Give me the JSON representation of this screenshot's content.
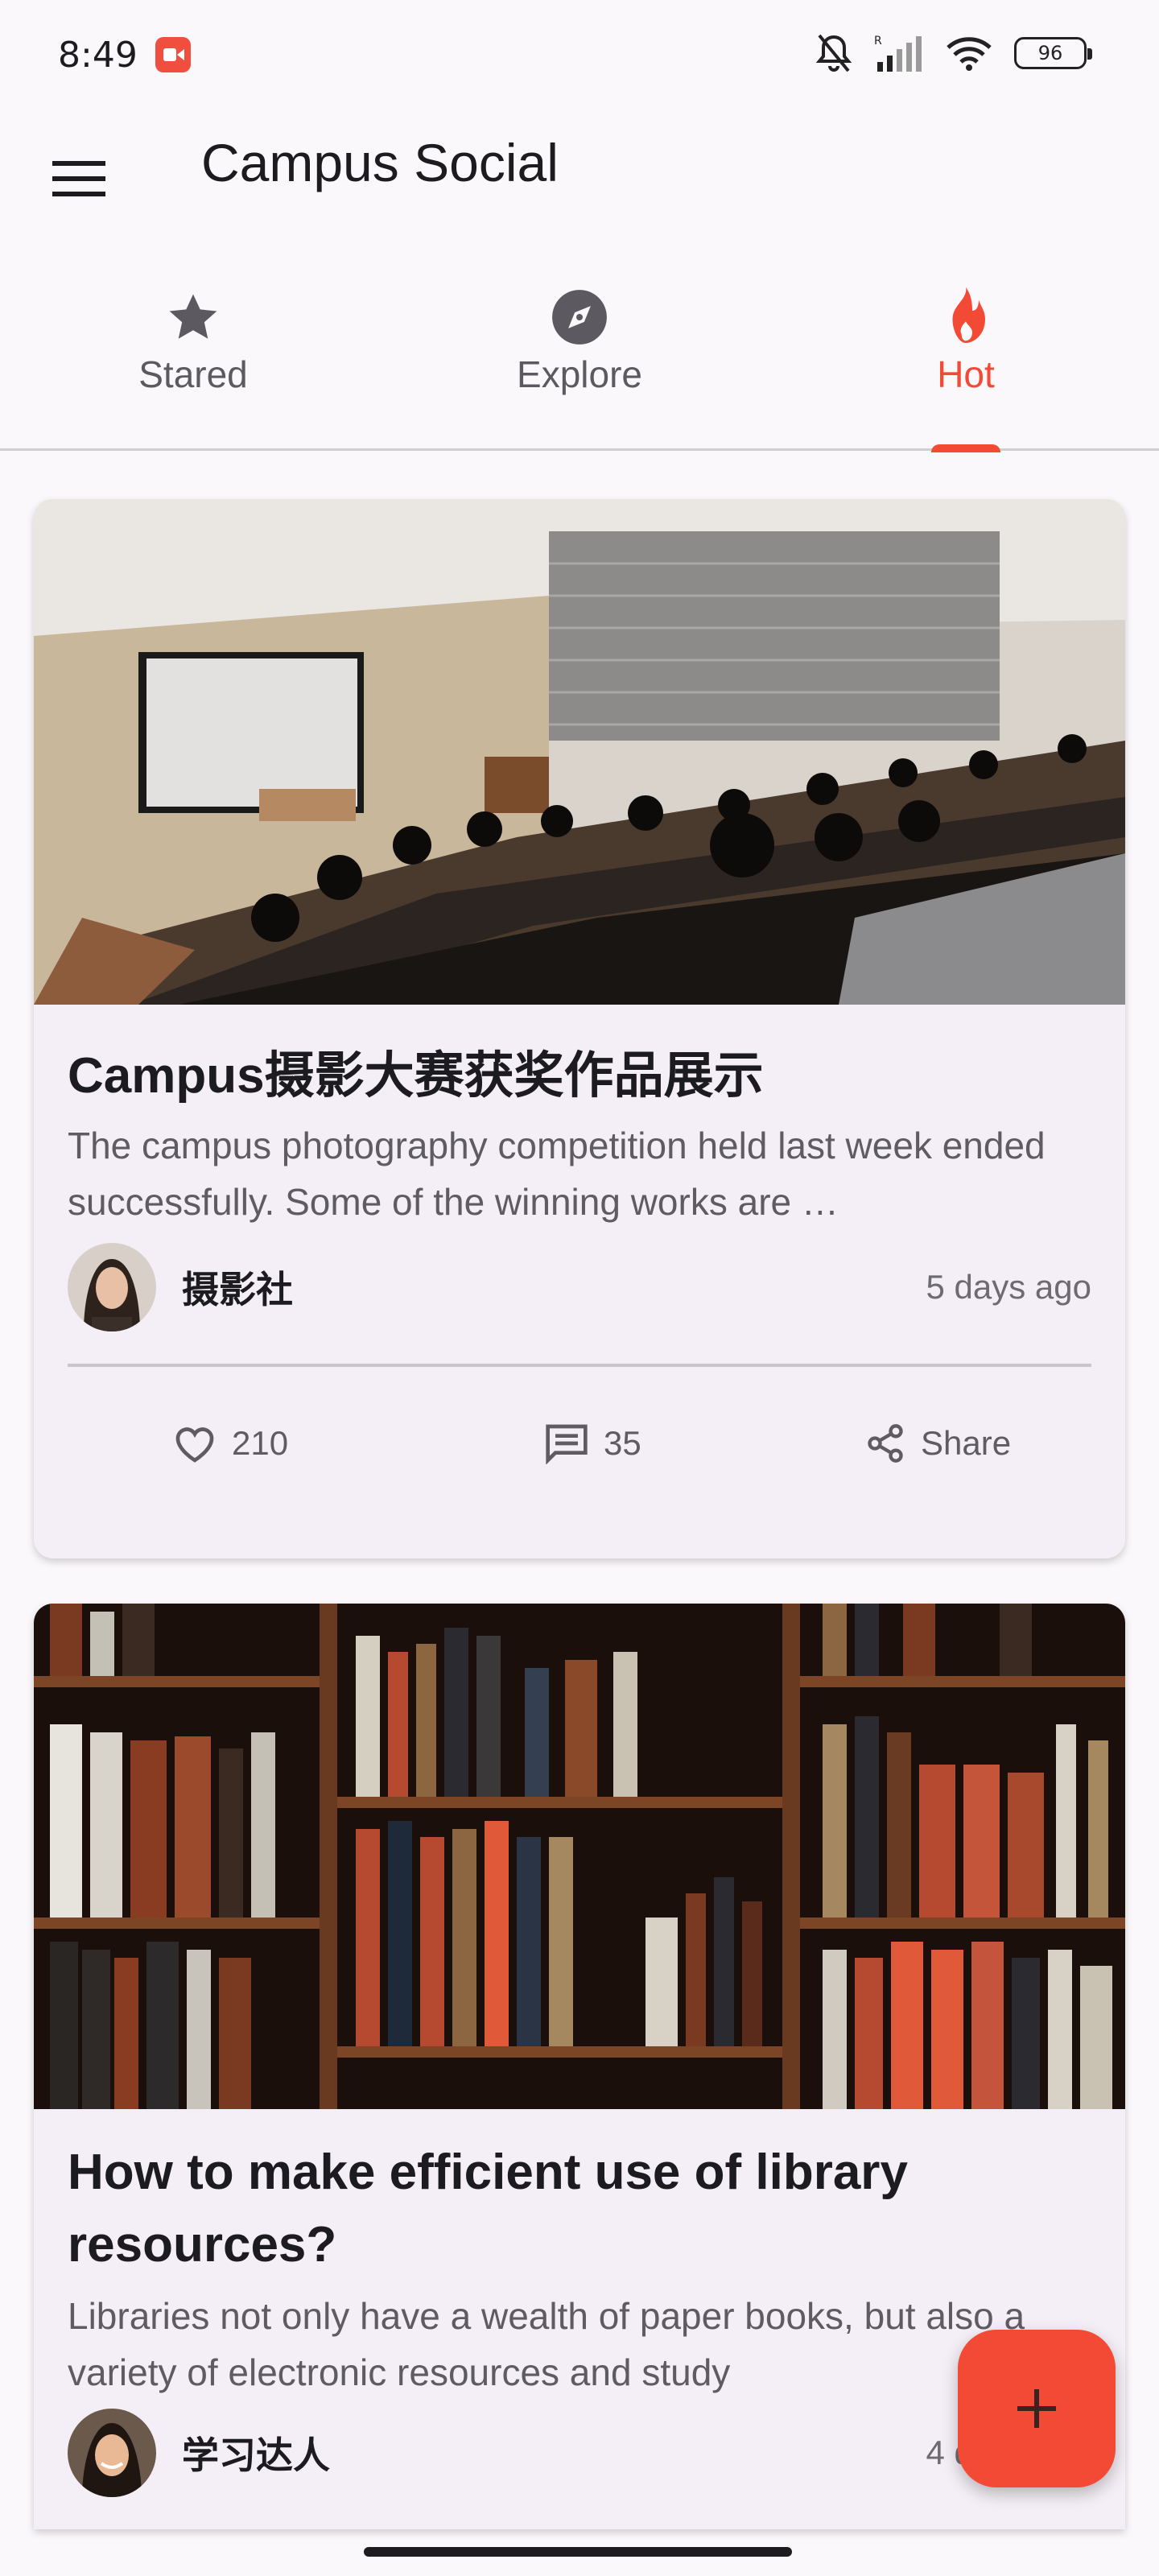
{
  "status_bar": {
    "time": "8:49",
    "battery": "96",
    "icons": [
      "screen-record-icon",
      "mute-icon",
      "signal-icon",
      "wifi-icon",
      "battery-icon"
    ]
  },
  "app_bar": {
    "title": "Campus Social",
    "menu_icon": "hamburger-menu-icon"
  },
  "tabs": [
    {
      "label": "Stared",
      "icon": "star-icon",
      "active": false
    },
    {
      "label": "Explore",
      "icon": "compass-icon",
      "active": false
    },
    {
      "label": "Hot",
      "icon": "fire-icon",
      "active": true
    }
  ],
  "colors": {
    "accent": "#f24a35",
    "background": "#fbf8fc",
    "card": "#f4eff6"
  },
  "posts": [
    {
      "image": "lecture-hall-photo",
      "title": "Campus摄影大赛获奖作品展示",
      "description": "The campus photography competition held last week ended successfully. Some of the winning works are …",
      "author": "摄影社",
      "time": "5 days ago",
      "likes": "210",
      "comments": "35",
      "share_label": "Share"
    },
    {
      "image": "library-bookshelf-photo",
      "title": "How to make efficient use of library resources?",
      "description": "Libraries not only have a wealth of paper books, but also a variety of electronic resources and study",
      "author": "学习达人",
      "time": "4 days ago"
    }
  ],
  "fab": {
    "icon": "plus-icon"
  }
}
